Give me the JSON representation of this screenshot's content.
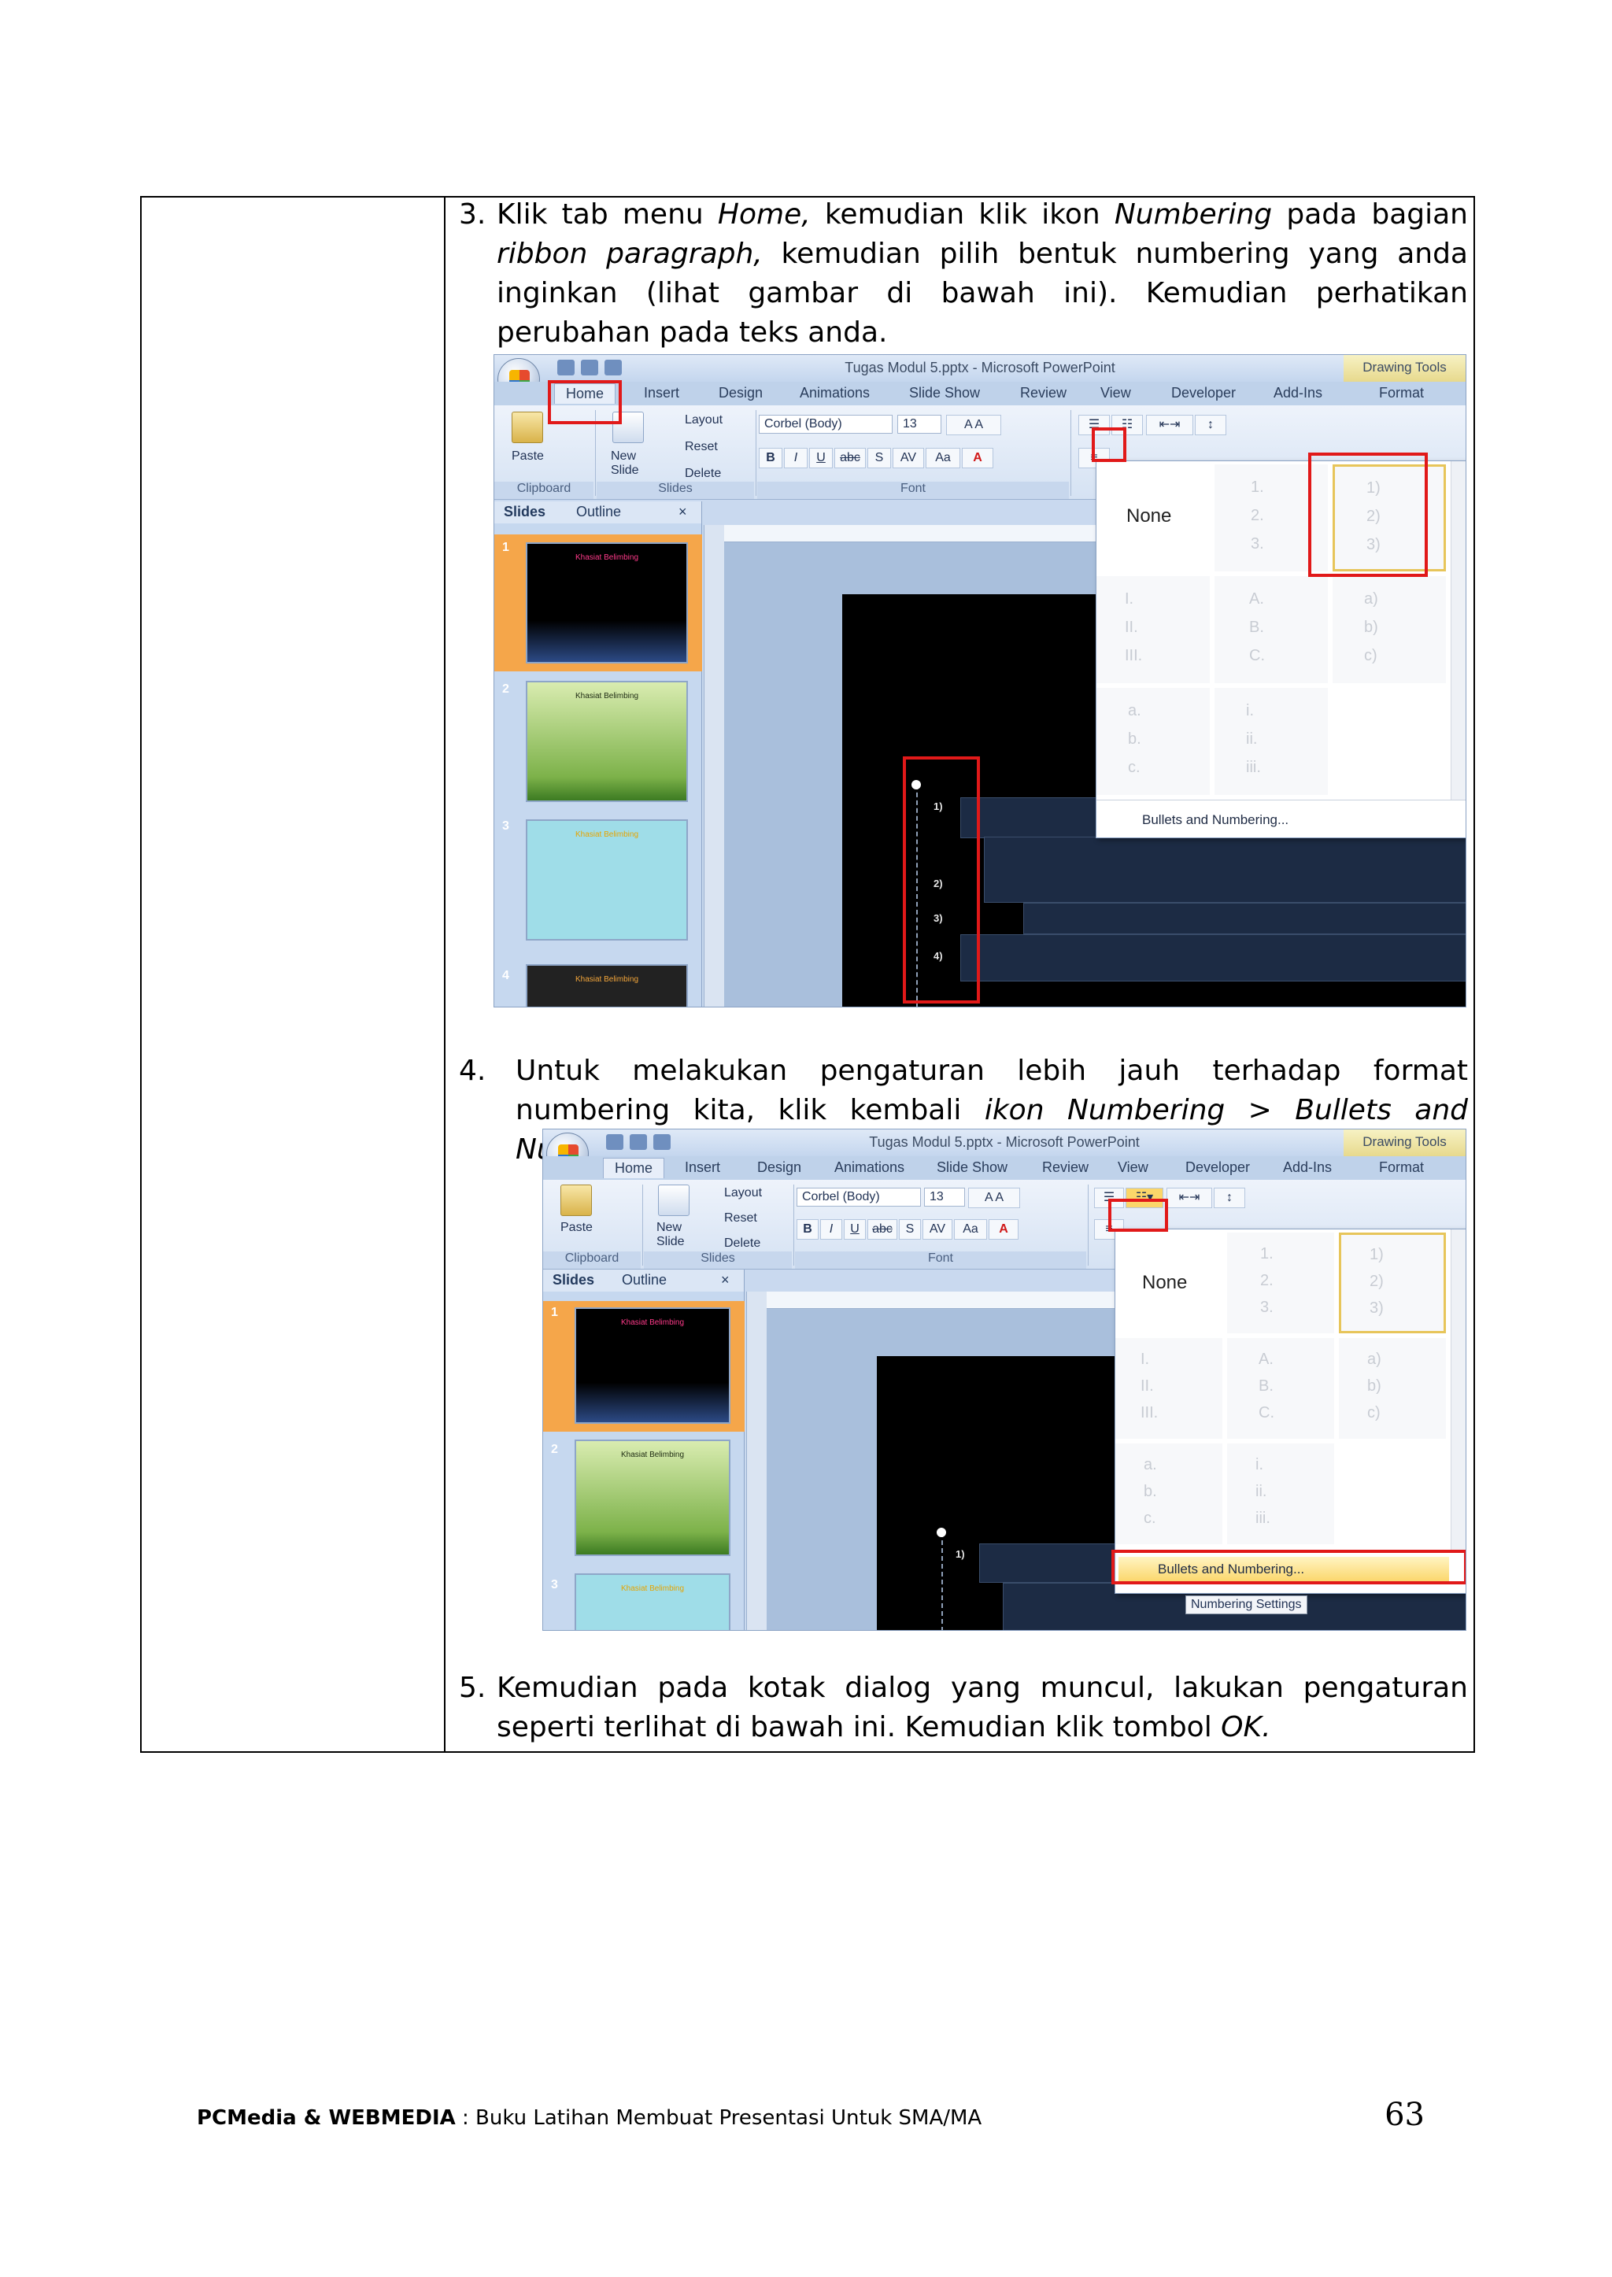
{
  "steps": {
    "s3": {
      "number": "3.",
      "parts": [
        "Klik tab menu ",
        "Home,",
        " kemudian klik ikon ",
        "Numbering",
        " pada bagian ",
        "ribbon paragraph,",
        " kemudian pilih bentuk numbering yang anda inginkan (lihat gambar di bawah ini). Kemudian perhatikan perubahan pada teks anda."
      ]
    },
    "s4": {
      "number": "4.",
      "parts": [
        "Untuk melakukan pengaturan lebih jauh terhadap format numbering kita, klik kembali ",
        "ikon Numbering > Bullets and Numbering."
      ]
    },
    "s5": {
      "number": "5.",
      "parts": [
        "Kemudian pada kotak dialog yang muncul, lakukan pengaturan seperti terlihat di bawah ini. Kemudian klik tombol ",
        "OK."
      ]
    }
  },
  "screenshot": {
    "window_title": "Tugas Modul 5.pptx - Microsoft PowerPoint",
    "drawing_tools": "Drawing Tools",
    "tabs": [
      "Home",
      "Insert",
      "Design",
      "Animations",
      "Slide Show",
      "Review",
      "View",
      "Developer",
      "Add-Ins",
      "Format"
    ],
    "clipboard": {
      "paste": "Paste",
      "label": "Clipboard"
    },
    "slides_group": {
      "new_slide": "New Slide",
      "layout": "Layout",
      "reset": "Reset",
      "delete": "Delete",
      "label": "Slides"
    },
    "font_group": {
      "font_name": "Corbel (Body)",
      "font_size": "13",
      "label": "Font",
      "bold": "B",
      "italic": "I",
      "underline": "U",
      "strike": "abc",
      "shadow": "S",
      "spacing": "AV",
      "case": "Aa"
    },
    "pane_tabs": {
      "slides": "Slides",
      "outline": "Outline",
      "close": "×"
    },
    "thumb_nums": [
      "1",
      "2",
      "3",
      "4"
    ],
    "thumb_titles": [
      "Khasiat Belimbing",
      "Khasiat Belimbing",
      "Khasiat Belimbing",
      "Khasiat Belimbing"
    ],
    "gallery": {
      "none": "None",
      "numerals_1": [
        "1.",
        "2.",
        "3."
      ],
      "numerals_paren": [
        "1)",
        "2)",
        "3)"
      ],
      "roman_upper": [
        "I.",
        "II.",
        "III."
      ],
      "alpha_upper": [
        "A.",
        "B.",
        "C."
      ],
      "alpha_paren": [
        "a)",
        "b)",
        "c)"
      ],
      "alpha_lower": [
        "a.",
        "b.",
        "c."
      ],
      "roman_lower": [
        "i.",
        "ii.",
        "iii."
      ],
      "bullets_and_numbering": "Bullets and Numbering...",
      "tooltip": "Numbering Settings"
    },
    "slide_list_numbers": [
      "1)",
      "2)",
      "3)",
      "4)"
    ]
  },
  "footer": {
    "publisher": "PCMedia & WEBMEDIA",
    "title": " : Buku Latihan Membuat Presentasi Untuk SMA/MA",
    "page": "63"
  },
  "colors": {
    "highlight_red": "#e11919",
    "ribbon_blue": "#c9d9ef"
  }
}
